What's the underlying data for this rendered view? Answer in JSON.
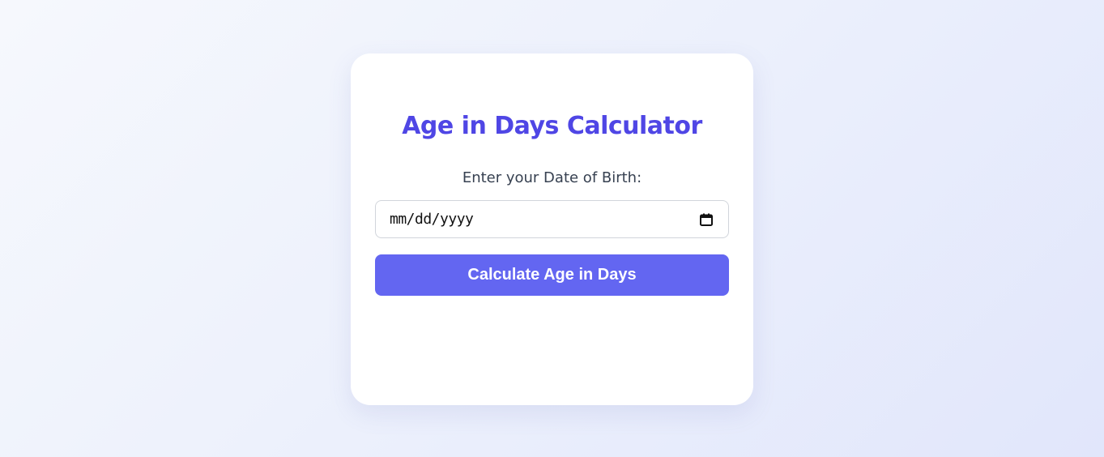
{
  "card": {
    "title": "Age in Days Calculator",
    "dob_label": "Enter your Date of Birth:",
    "date_input": {
      "placeholder": "mm/dd/yyyy",
      "value": ""
    },
    "calculate_button_label": "Calculate Age in Days",
    "result_text": ""
  },
  "colors": {
    "accent": "#4f46e5",
    "button": "#6366f1",
    "label_text": "#374151",
    "input_border": "#d1d5db"
  },
  "icons": {
    "date_picker": "calendar-icon"
  }
}
